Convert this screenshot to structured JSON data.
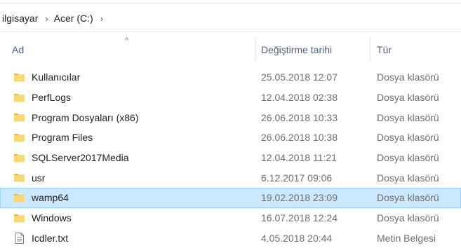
{
  "breadcrumb": {
    "items": [
      "ilgisayar",
      "Acer (C:)"
    ],
    "separator": "›"
  },
  "columns": {
    "name": "Ad",
    "date": "Değiştirme tarihi",
    "type": "Tür",
    "sort_indicator": "^"
  },
  "colors": {
    "folder": "#f8d775",
    "folder_dark": "#e0b94a",
    "selected_bg": "#cce8ff",
    "header_text": "#4c607a"
  },
  "files": [
    {
      "name": "Kullanıcılar",
      "date": "25.05.2018 12:07",
      "type": "Dosya klasörü",
      "icon": "folder-icon",
      "selected": false
    },
    {
      "name": "PerfLogs",
      "date": "12.04.2018 02:38",
      "type": "Dosya klasörü",
      "icon": "folder-icon",
      "selected": false
    },
    {
      "name": "Program Dosyaları (x86)",
      "date": "26.06.2018 10:33",
      "type": "Dosya klasörü",
      "icon": "folder-icon",
      "selected": false
    },
    {
      "name": "Program Files",
      "date": "26.06.2018 10:38",
      "type": "Dosya klasörü",
      "icon": "folder-icon",
      "selected": false
    },
    {
      "name": "SQLServer2017Media",
      "date": "12.04.2018 11:21",
      "type": "Dosya klasörü",
      "icon": "folder-icon",
      "selected": false
    },
    {
      "name": "usr",
      "date": "6.12.2017 09:06",
      "type": "Dosya klasörü",
      "icon": "folder-icon",
      "selected": false
    },
    {
      "name": "wamp64",
      "date": "19.02.2018 23:09",
      "type": "Dosya klasörü",
      "icon": "folder-icon",
      "selected": true
    },
    {
      "name": "Windows",
      "date": "16.07.2018 12:24",
      "type": "Dosya klasörü",
      "icon": "folder-icon",
      "selected": false
    },
    {
      "name": "Icdler.txt",
      "date": "4.05.2018 20:44",
      "type": "Metin Belgesi",
      "icon": "text-file-icon",
      "selected": false
    }
  ]
}
